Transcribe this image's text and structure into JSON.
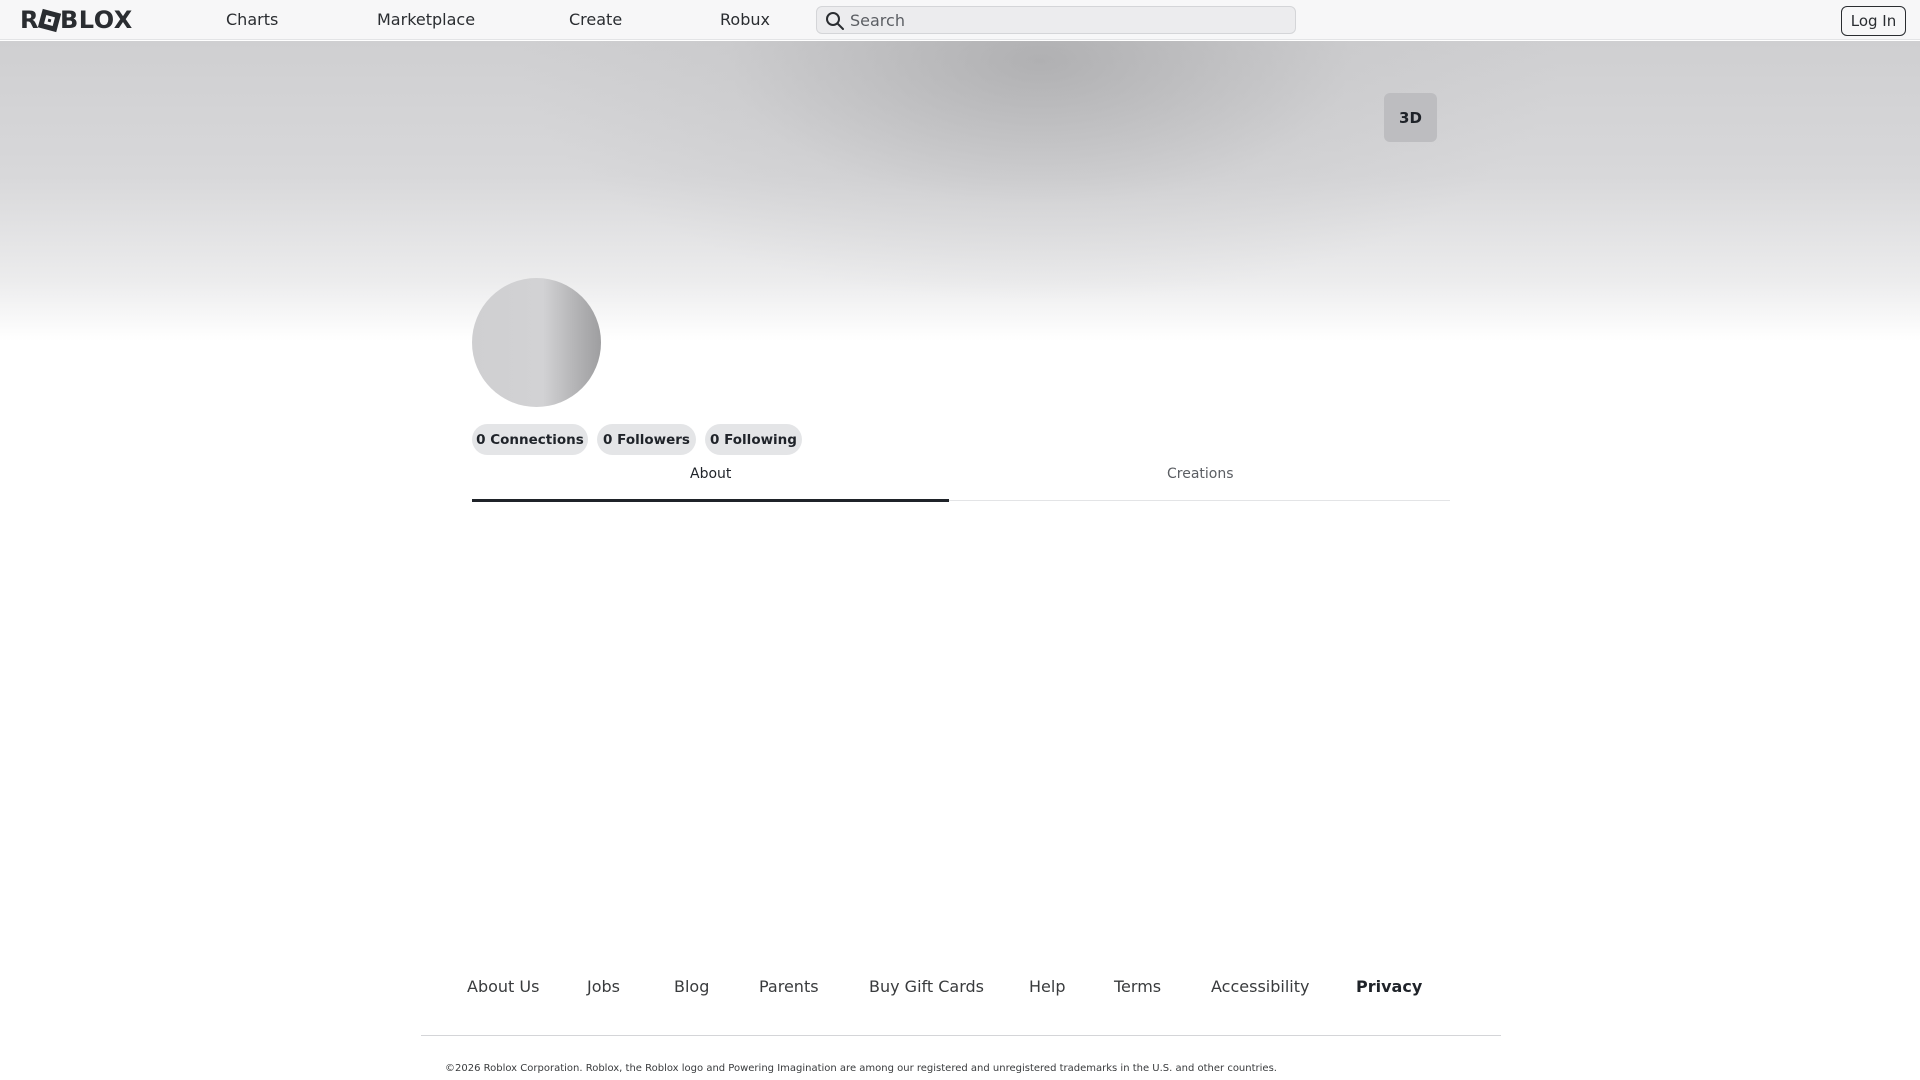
{
  "header": {
    "logo_text": "ROBLOX",
    "nav": [
      "Charts",
      "Marketplace",
      "Create",
      "Robux"
    ],
    "search_placeholder": "Search",
    "login_label": "Log In"
  },
  "banner": {
    "view_3d_label": "3D"
  },
  "profile": {
    "stats": {
      "connections": "0 Connections",
      "followers": "0 Followers",
      "following": "0 Following"
    },
    "tabs": [
      {
        "label": "About",
        "active": true
      },
      {
        "label": "Creations",
        "active": false
      }
    ]
  },
  "footer": {
    "links": [
      "About Us",
      "Jobs",
      "Blog",
      "Parents",
      "Buy Gift Cards",
      "Help",
      "Terms",
      "Accessibility",
      "Privacy"
    ],
    "copyright": "©2026 Roblox Corporation. Roblox, the Roblox logo and Powering Imagination are among our registered and unregistered trademarks in the U.S. and other countries."
  },
  "colors": {
    "text": "#1f2329",
    "nav_bg": "#f7f7f8",
    "pill_bg": "#e4e5e7",
    "active_tab": "#1f2329",
    "inactive_tab": "#5b5e63"
  }
}
